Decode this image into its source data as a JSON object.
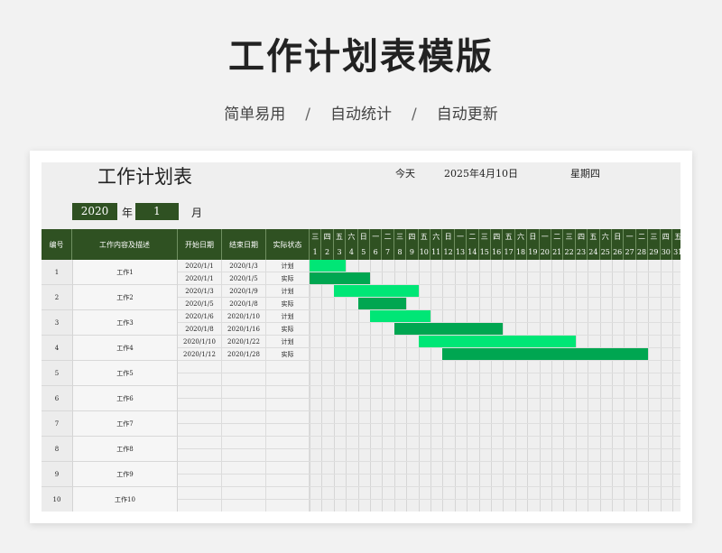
{
  "hero": {
    "title": "工作计划表模版",
    "features": [
      "简单易用",
      "自动统计",
      "自动更新"
    ],
    "separator": "/"
  },
  "sheet": {
    "title": "工作计划表",
    "today_label": "今天",
    "today_value": "2025年4月10日",
    "weekday": "星期四",
    "year": "2020",
    "year_unit": "年",
    "month": "1",
    "month_unit": "月"
  },
  "table": {
    "headers": {
      "index": "编号",
      "desc": "工作内容及描述",
      "start": "开始日期",
      "end": "结束日期",
      "status": "实际状态"
    },
    "weekdays": [
      "三",
      "四",
      "五",
      "六",
      "日",
      "一",
      "二",
      "三",
      "四",
      "五",
      "六",
      "日",
      "一",
      "二",
      "三",
      "四",
      "五",
      "六",
      "日",
      "一",
      "二",
      "三",
      "四",
      "五",
      "六",
      "日",
      "一",
      "二",
      "三",
      "四",
      "五"
    ],
    "days": [
      "1",
      "2",
      "3",
      "4",
      "5",
      "6",
      "7",
      "8",
      "9",
      "10",
      "11",
      "12",
      "13",
      "14",
      "15",
      "16",
      "17",
      "18",
      "19",
      "20",
      "21",
      "22",
      "23",
      "24",
      "25",
      "26",
      "27",
      "28",
      "29",
      "30",
      "31"
    ],
    "colors": {
      "plan": "#00e676",
      "actual": "#00a651",
      "header_bg": "#2f5122"
    },
    "rows": [
      {
        "index": "1",
        "name": "工作1",
        "subrows": [
          {
            "start": "2020/1/1",
            "end": "2020/1/3",
            "status": "计划",
            "bar_start_day": 1,
            "bar_end_day": 3,
            "kind": "plan"
          },
          {
            "start": "2020/1/1",
            "end": "2020/1/5",
            "status": "实际",
            "bar_start_day": 1,
            "bar_end_day": 5,
            "kind": "actual"
          }
        ]
      },
      {
        "index": "2",
        "name": "工作2",
        "subrows": [
          {
            "start": "2020/1/3",
            "end": "2020/1/9",
            "status": "计划",
            "bar_start_day": 3,
            "bar_end_day": 9,
            "kind": "plan"
          },
          {
            "start": "2020/1/5",
            "end": "2020/1/8",
            "status": "实际",
            "bar_start_day": 5,
            "bar_end_day": 8,
            "kind": "actual"
          }
        ]
      },
      {
        "index": "3",
        "name": "工作3",
        "subrows": [
          {
            "start": "2020/1/6",
            "end": "2020/1/10",
            "status": "计划",
            "bar_start_day": 6,
            "bar_end_day": 10,
            "kind": "plan"
          },
          {
            "start": "2020/1/8",
            "end": "2020/1/16",
            "status": "实际",
            "bar_start_day": 8,
            "bar_end_day": 16,
            "kind": "actual"
          }
        ]
      },
      {
        "index": "4",
        "name": "工作4",
        "subrows": [
          {
            "start": "2020/1/10",
            "end": "2020/1/22",
            "status": "计划",
            "bar_start_day": 10,
            "bar_end_day": 22,
            "kind": "plan"
          },
          {
            "start": "2020/1/12",
            "end": "2020/1/28",
            "status": "实际",
            "bar_start_day": 12,
            "bar_end_day": 28,
            "kind": "actual"
          }
        ]
      },
      {
        "index": "5",
        "name": "工作5",
        "subrows": []
      },
      {
        "index": "6",
        "name": "工作6",
        "subrows": []
      },
      {
        "index": "7",
        "name": "工作7",
        "subrows": []
      },
      {
        "index": "8",
        "name": "工作8",
        "subrows": []
      },
      {
        "index": "9",
        "name": "工作9",
        "subrows": []
      },
      {
        "index": "10",
        "name": "工作10",
        "subrows": []
      }
    ]
  }
}
